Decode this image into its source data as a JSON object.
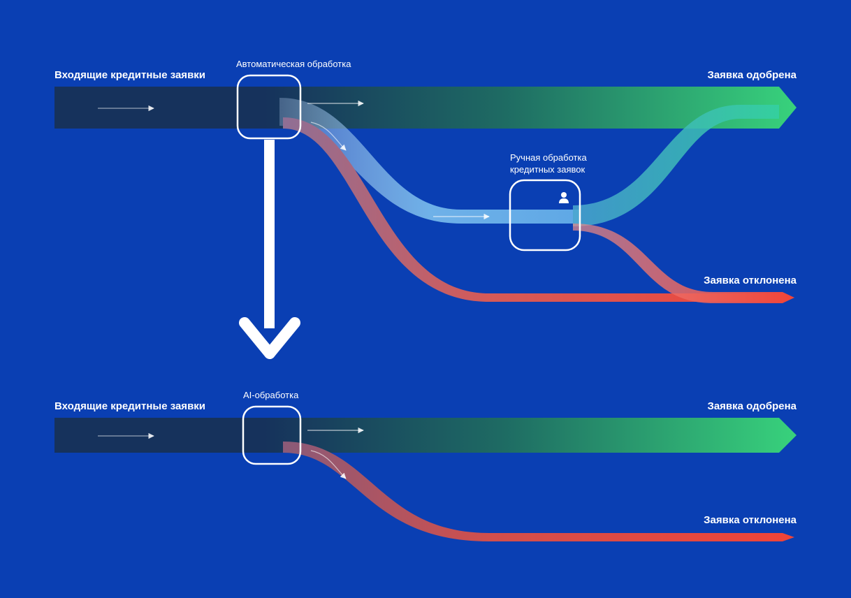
{
  "top": {
    "incoming": "Входящие кредитные заявки",
    "auto": "Автоматическая обработка",
    "manual_l1": "Ручная обработка",
    "manual_l2": "кредитных заявок",
    "approved": "Заявка одобрена",
    "rejected": "Заявка отклонена"
  },
  "bottom": {
    "incoming": "Входящие кредитные заявки",
    "ai": "AI-обработка",
    "approved": "Заявка одобрена",
    "rejected": "Заявка отклонена"
  },
  "colors": {
    "bg": "#0a3fb3",
    "dark": "#16325c",
    "green": "#38d27c",
    "red": "#f04438",
    "cyan": "#29bdc1",
    "lblue": "#5fa8e6",
    "white": "#ffffff"
  }
}
